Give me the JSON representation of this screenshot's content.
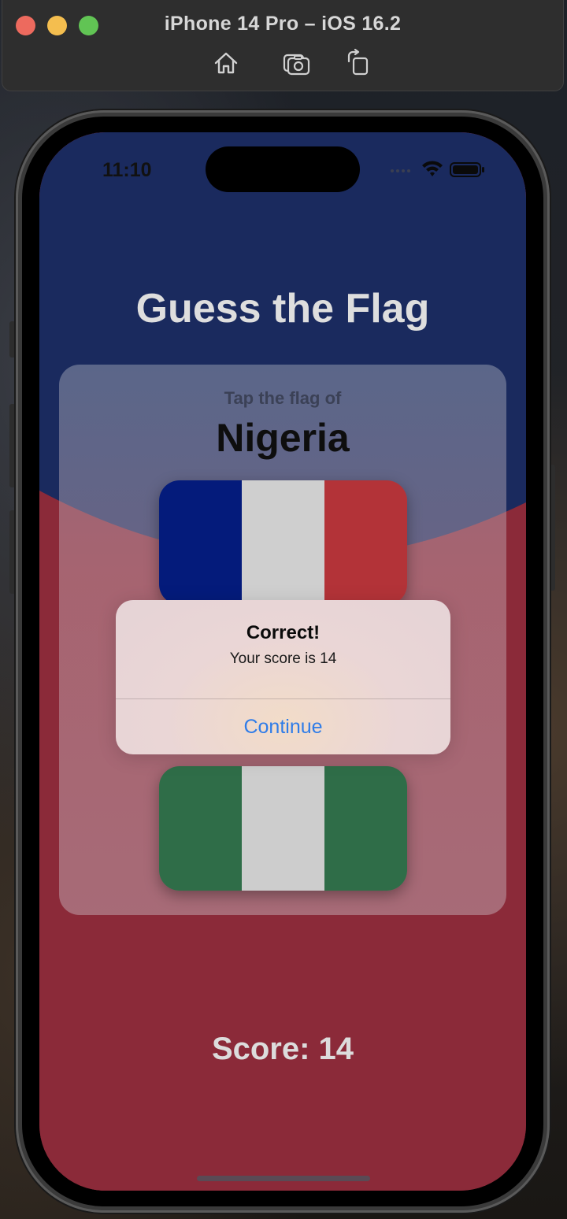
{
  "simulator": {
    "window_title": "iPhone 14 Pro – iOS 16.2",
    "toolbar": [
      {
        "icon": "home-icon"
      },
      {
        "icon": "screenshot-icon"
      },
      {
        "icon": "rotate-icon"
      }
    ]
  },
  "status_bar": {
    "time": "11:10",
    "icons": [
      "cellular-icon",
      "wifi-icon",
      "battery-icon"
    ]
  },
  "app": {
    "title": "Guess the Flag",
    "prompt": "Tap the flag of",
    "country": "Nigeria",
    "flags": [
      {
        "country": "France",
        "stripes": [
          "#041b7b",
          "#cfcfcf",
          "#b33338"
        ]
      },
      {
        "country": "Nigeria",
        "stripes": [
          "#2f6d48",
          "#cdcdcd",
          "#2f6d48"
        ]
      }
    ],
    "score_label": "Score: 14"
  },
  "alert": {
    "title": "Correct!",
    "message": "Your score is 14",
    "button": "Continue"
  },
  "colors": {
    "background_top": "#1a2a5e",
    "background_bottom": "#8b2a39",
    "link_blue": "#2f7ce8"
  }
}
